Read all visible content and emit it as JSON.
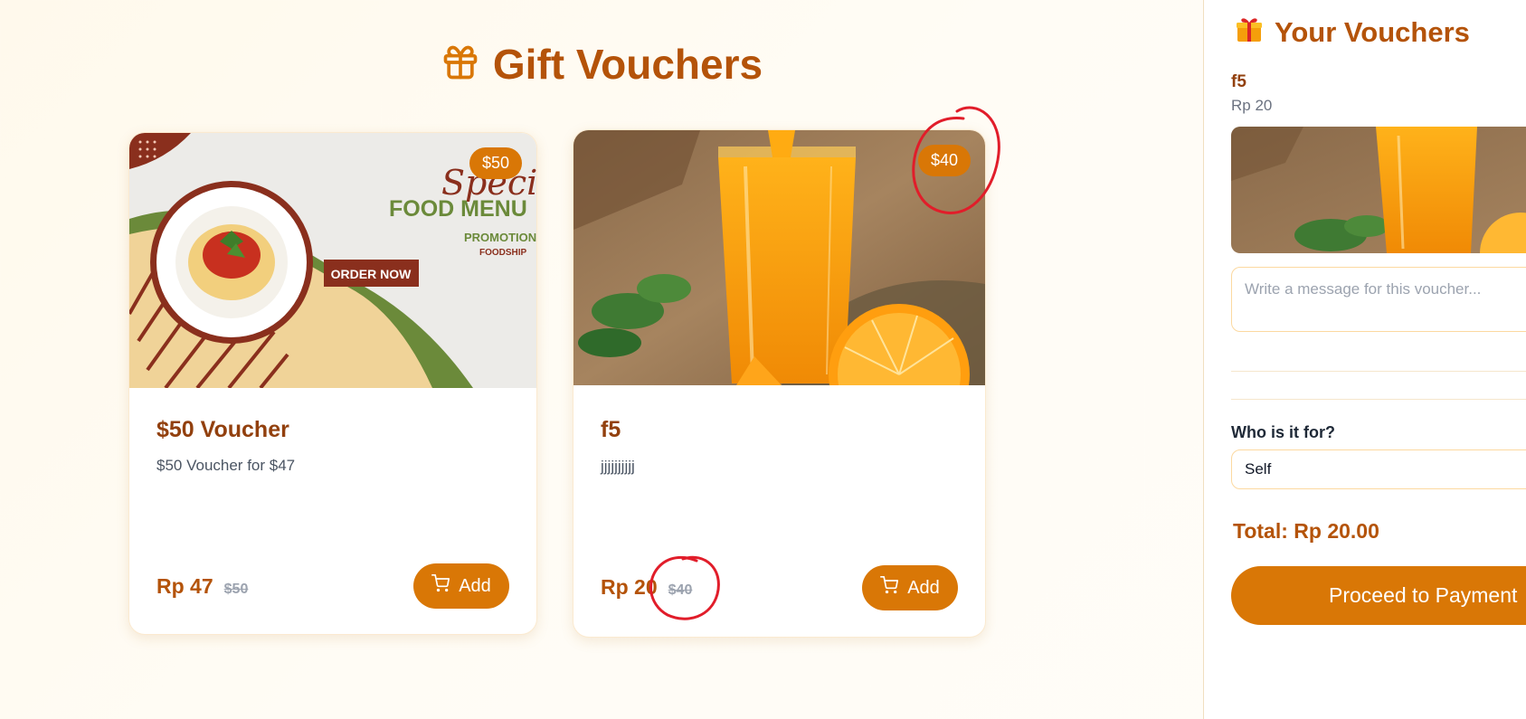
{
  "page": {
    "title": "Gift Vouchers",
    "title_icon": "gift-icon"
  },
  "vouchers": [
    {
      "badge": "$50",
      "name": "$50 Voucher",
      "description": "$50 Voucher for $47",
      "price": "Rp 47",
      "old_price": "$50",
      "add_label": "Add",
      "image": {
        "script_text": "Special",
        "headline": "FOOD MENU",
        "sub1": "PROMOTION",
        "sub2": "FOODSHIP",
        "cta": "ORDER NOW"
      }
    },
    {
      "badge": "$40",
      "name": "f5",
      "description": "jjjjjjjjjj",
      "price": "Rp 20",
      "old_price": "$40",
      "add_label": "Add"
    }
  ],
  "sidebar": {
    "title": "Your Vouchers",
    "title_icon": "gift-box-icon",
    "item": {
      "name": "f5",
      "price": "Rp 20"
    },
    "message_placeholder": "Write a message for this voucher...",
    "recipient_label": "Who is it for?",
    "recipient_value": "Self",
    "total": "Total: Rp 20.00",
    "pay_label": "Proceed to Payment"
  },
  "colors": {
    "accent": "#d97706",
    "title": "#b45309",
    "heading": "#92400e",
    "annotation": "#e11d2a"
  }
}
